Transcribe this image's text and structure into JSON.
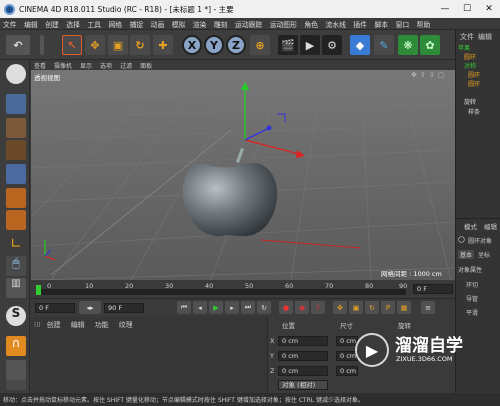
{
  "titlebar": {
    "title": "CINEMA 4D R18.011 Studio (RC - R18) - [未标题 1 *] - 主要",
    "min": "—",
    "max": "☐",
    "close": "✕"
  },
  "menu": [
    "文件",
    "编辑",
    "创建",
    "选择",
    "工具",
    "网格",
    "捕捉",
    "动画",
    "模拟",
    "渲染",
    "雕刻",
    "运动跟踪",
    "运动图形",
    "角色",
    "流水线",
    "插件",
    "脚本",
    "窗口",
    "帮助"
  ],
  "toolbar": {
    "x": "X",
    "y": "Y",
    "z": "Z"
  },
  "viewport": {
    "menu": [
      "查看",
      "摄像机",
      "显示",
      "选项",
      "过滤",
      "面板"
    ],
    "label": "透视视图",
    "grid_info": "网格间距 : 1000 cm"
  },
  "timeline": {
    "ticks": [
      "0",
      "10",
      "20",
      "30",
      "40",
      "50",
      "60",
      "70",
      "80",
      "90"
    ],
    "end_field": "0 F"
  },
  "transport": {
    "start": "0 F",
    "end": "90 F"
  },
  "material": {
    "menu": [
      "创建",
      "编辑",
      "功能",
      "纹理"
    ]
  },
  "coords": {
    "headers": [
      "位置",
      "尺寸",
      "旋转"
    ],
    "rows": [
      {
        "axis": "X",
        "pos": "0 cm",
        "size": "0 cm"
      },
      {
        "axis": "Y",
        "pos": "0 cm",
        "size": "0 cm"
      },
      {
        "axis": "Z",
        "pos": "0 cm",
        "size": "0 cm"
      }
    ],
    "mode": "对象 (相对)"
  },
  "right": {
    "tabs": [
      "文件",
      "编辑"
    ],
    "objects": [
      "苹果",
      "圆环",
      "对称",
      "圆环",
      "圆环",
      "旋转",
      "样条"
    ],
    "attr_tabs": [
      "模式",
      "编辑"
    ],
    "attr_obj": "圆环对象",
    "attr_sub": [
      "基本",
      "坐标"
    ],
    "attr_title": "对象属性",
    "props": [
      "环切",
      "导管",
      "平滑"
    ]
  },
  "status": "移动：点击并拖动鼠标移动元素。按住 SHIFT 键量化移动；节点编辑模式时按住 SHIFT 键增加选择对象；按住 CTRL 键减少选择对象。",
  "watermark": {
    "text": "溜溜自学",
    "sub": "ZIXUE.3D66.COM"
  }
}
